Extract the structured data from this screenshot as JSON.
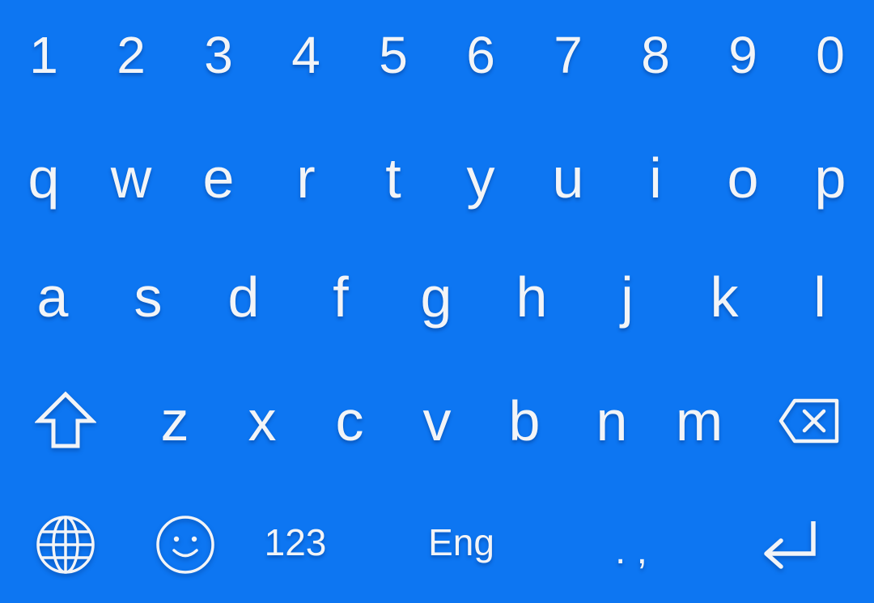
{
  "theme": {
    "background": "#0d76f2",
    "key_text": "#f2f4f7"
  },
  "keyboard": {
    "number_row": [
      "1",
      "2",
      "3",
      "4",
      "5",
      "6",
      "7",
      "8",
      "9",
      "0"
    ],
    "row_qwerty": [
      "q",
      "w",
      "e",
      "r",
      "t",
      "y",
      "u",
      "i",
      "o",
      "p"
    ],
    "row_home": [
      "a",
      "s",
      "d",
      "f",
      "g",
      "h",
      "j",
      "k",
      "l"
    ],
    "row_bottom": [
      "z",
      "x",
      "c",
      "v",
      "b",
      "n",
      "m"
    ],
    "function_row": {
      "symbols_label": "123",
      "language_label": "Eng",
      "punctuation_label": ". ,"
    },
    "icons": {
      "shift": "shift-icon",
      "backspace": "backspace-icon",
      "language_switch": "globe-icon",
      "emoji": "emoji-icon",
      "enter": "enter-icon"
    }
  }
}
